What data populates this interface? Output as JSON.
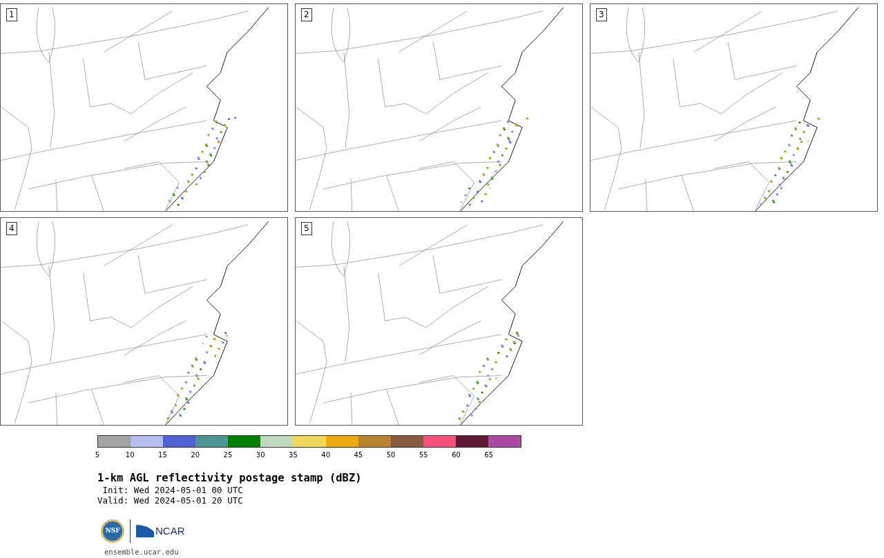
{
  "panels": [
    {
      "label": "1"
    },
    {
      "label": "2"
    },
    {
      "label": "3"
    },
    {
      "label": "4"
    },
    {
      "label": "5"
    }
  ],
  "colorbar": {
    "bins": [
      {
        "color": "#a3a3a3",
        "tick": "5"
      },
      {
        "color": "#b4bdeb",
        "tick": "10"
      },
      {
        "color": "#5060d6",
        "tick": "15"
      },
      {
        "color": "#4e9598",
        "tick": "20"
      },
      {
        "color": "#008000",
        "tick": "25"
      },
      {
        "color": "#bcdbbc",
        "tick": "30"
      },
      {
        "color": "#efd85a",
        "tick": "35"
      },
      {
        "color": "#efab12",
        "tick": "40"
      },
      {
        "color": "#bb8330",
        "tick": "45"
      },
      {
        "color": "#8b5a3c",
        "tick": "50"
      },
      {
        "color": "#f5517b",
        "tick": "55"
      },
      {
        "color": "#621734",
        "tick": "60"
      },
      {
        "color": "#ab4aa2",
        "tick": "65"
      }
    ]
  },
  "title": "1-km AGL reflectivity postage stamp (dBZ)",
  "init": " Init: Wed 2024-05-01 00 UTC",
  "valid": "Valid: Wed 2024-05-01 20 UTC",
  "logos": {
    "nsf": "NSF",
    "ncar": "NCAR"
  },
  "url": "ensemble.ucar.edu"
}
